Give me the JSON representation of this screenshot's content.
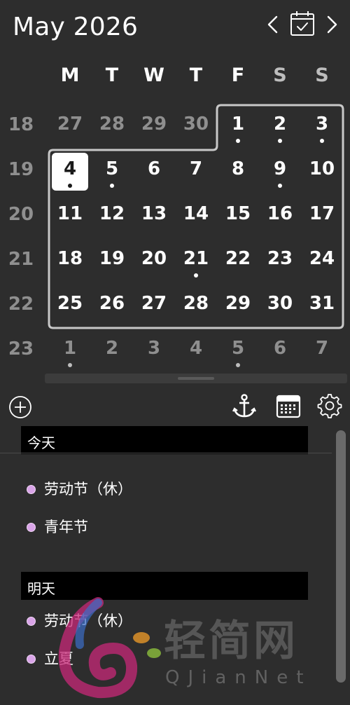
{
  "header": {
    "title": "May 2026"
  },
  "weekdays": [
    "M",
    "T",
    "W",
    "T",
    "F",
    "S",
    "S"
  ],
  "week_numbers": [
    "18",
    "19",
    "20",
    "21",
    "22",
    "23"
  ],
  "days": [
    {
      "d": "27",
      "other": true
    },
    {
      "d": "28",
      "other": true
    },
    {
      "d": "29",
      "other": true
    },
    {
      "d": "30",
      "other": true
    },
    {
      "d": "1",
      "dot": true
    },
    {
      "d": "2",
      "dot": true
    },
    {
      "d": "3",
      "dot": true
    },
    {
      "d": "4",
      "today": true,
      "dot": true
    },
    {
      "d": "5",
      "dot": true
    },
    {
      "d": "6"
    },
    {
      "d": "7"
    },
    {
      "d": "8"
    },
    {
      "d": "9",
      "dot": true
    },
    {
      "d": "10"
    },
    {
      "d": "11"
    },
    {
      "d": "12"
    },
    {
      "d": "13"
    },
    {
      "d": "14"
    },
    {
      "d": "15"
    },
    {
      "d": "16"
    },
    {
      "d": "17"
    },
    {
      "d": "18"
    },
    {
      "d": "19"
    },
    {
      "d": "20"
    },
    {
      "d": "21",
      "dot": true
    },
    {
      "d": "22"
    },
    {
      "d": "23"
    },
    {
      "d": "24"
    },
    {
      "d": "25"
    },
    {
      "d": "26"
    },
    {
      "d": "27"
    },
    {
      "d": "28"
    },
    {
      "d": "29"
    },
    {
      "d": "30"
    },
    {
      "d": "31"
    },
    {
      "d": "1",
      "other": true,
      "dot": true
    },
    {
      "d": "2",
      "other": true
    },
    {
      "d": "3",
      "other": true
    },
    {
      "d": "4",
      "other": true
    },
    {
      "d": "5",
      "other": true,
      "dot": true
    },
    {
      "d": "6",
      "other": true
    },
    {
      "d": "7",
      "other": true
    }
  ],
  "agenda": {
    "today": {
      "heading": "今天",
      "events": [
        "劳动节（休）",
        "青年节"
      ]
    },
    "tomorrow": {
      "heading": "明天",
      "events": [
        "劳动节（休）",
        "立夏"
      ]
    }
  },
  "watermark": {
    "text": "轻简网",
    "sub": "QJianNet"
  },
  "colors": {
    "background": "#2d2d2d",
    "event_bullet": "#d9a4e8",
    "section_bg": "#000000"
  }
}
